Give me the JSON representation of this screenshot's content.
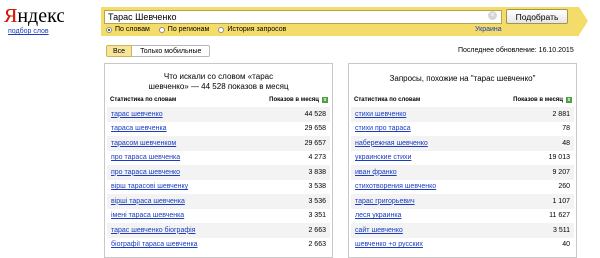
{
  "logo": "Яндекс",
  "sublink": "подбор слов",
  "search": {
    "value": "Тарас Шевченко",
    "button": "Подобрать",
    "radios": [
      "По словам",
      "По регионам",
      "История запросов"
    ],
    "region": "Украина"
  },
  "tabs": [
    "Все",
    "Только мобильные"
  ],
  "updated": "Последнее обновление: 16.10.2015",
  "left": {
    "title": "Что искали со словом «тарас шевченко» — 44 528 показов в месяц",
    "col1": "Статистика по словам",
    "col2": "Показов в месяц",
    "rows": [
      {
        "kw": "тарас шевченко",
        "n": "44 528"
      },
      {
        "kw": "тараса шевченка",
        "n": "29 658"
      },
      {
        "kw": "тарасом шевченком",
        "n": "29 657"
      },
      {
        "kw": "про тараса шевченка",
        "n": "4 273"
      },
      {
        "kw": "про тараса шевченко",
        "n": "3 838"
      },
      {
        "kw": "вірш тарасові шевченку",
        "n": "3 538"
      },
      {
        "kw": "вірші тараса шевченка",
        "n": "3 536"
      },
      {
        "kw": "імені тараса шевченка",
        "n": "3 351"
      },
      {
        "kw": "тарас шевченко біографія",
        "n": "2 663"
      },
      {
        "kw": "біографії тараса шевченка",
        "n": "2 663"
      }
    ]
  },
  "right": {
    "title": "Запросы, похожие на \"тарас шевченко\"",
    "col1": "Статистика по словам",
    "col2": "Показов в месяц",
    "rows": [
      {
        "kw": "стихи шевченко",
        "n": "2 881"
      },
      {
        "kw": "стихи про тараса",
        "n": "78"
      },
      {
        "kw": "набережная шевченко",
        "n": "48"
      },
      {
        "kw": "украинские стихи",
        "n": "19 013"
      },
      {
        "kw": "иван франко",
        "n": "9 207"
      },
      {
        "kw": "стихотворения шевченко",
        "n": "260"
      },
      {
        "kw": "тарас григорьевич",
        "n": "1 107"
      },
      {
        "kw": "леся украинка",
        "n": "11 627"
      },
      {
        "kw": "сайт шевченко",
        "n": "3 511"
      },
      {
        "kw": "шевченко +о русских",
        "n": "40"
      }
    ]
  }
}
